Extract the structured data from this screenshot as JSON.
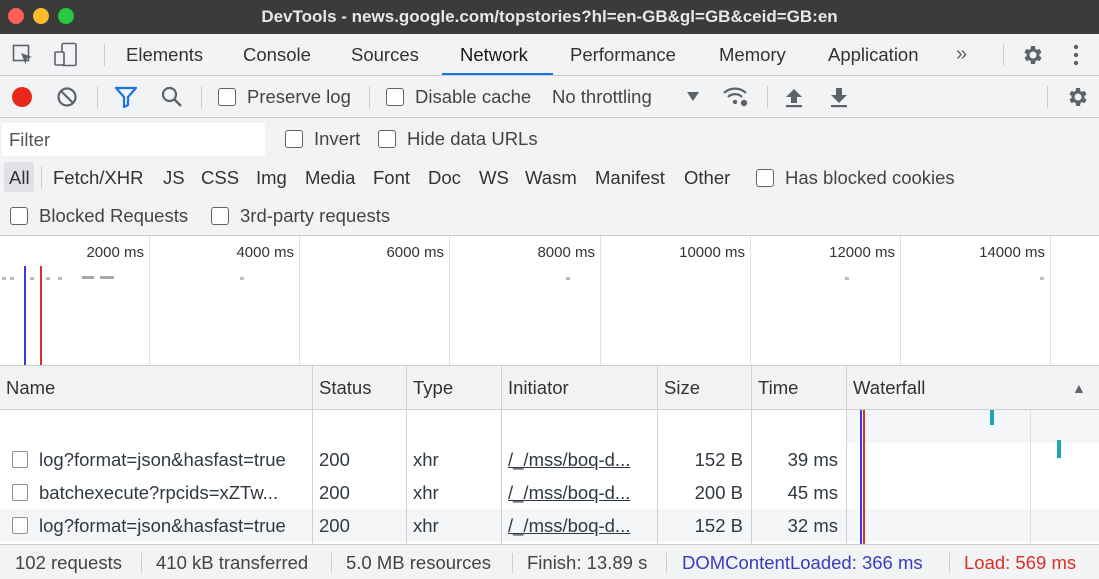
{
  "window": {
    "title": "DevTools - news.google.com/topstories?hl=en-GB&gl=GB&ceid=GB:en"
  },
  "tabs": [
    {
      "label": "Elements"
    },
    {
      "label": "Console"
    },
    {
      "label": "Sources"
    },
    {
      "label": "Network",
      "active": true
    },
    {
      "label": "Performance"
    },
    {
      "label": "Memory"
    },
    {
      "label": "Application"
    }
  ],
  "tab_overflow": "»",
  "toolbar": {
    "preserve_log_label": "Preserve log",
    "disable_cache_label": "Disable cache",
    "throttling_value": "No throttling",
    "record_color": "#e8281b",
    "filter_active_color": "#1a73e8"
  },
  "filters": {
    "filter_placeholder": "Filter",
    "invert_label": "Invert",
    "hide_data_urls_label": "Hide data URLs",
    "types": [
      "All",
      "Fetch/XHR",
      "JS",
      "CSS",
      "Img",
      "Media",
      "Font",
      "Doc",
      "WS",
      "Wasm",
      "Manifest",
      "Other"
    ],
    "active_type": "All",
    "has_blocked_cookies_label": "Has blocked cookies",
    "blocked_requests_label": "Blocked Requests",
    "third_party_label": "3rd-party requests"
  },
  "overview": {
    "ticks": [
      "2000 ms",
      "4000 ms",
      "6000 ms",
      "8000 ms",
      "10000 ms",
      "12000 ms",
      "14000 ms"
    ],
    "dom_content_loaded_color": "#3b3bd6",
    "load_color": "#d93025"
  },
  "table": {
    "columns": [
      "Name",
      "Status",
      "Type",
      "Initiator",
      "Size",
      "Time",
      "Waterfall"
    ],
    "sort_indicator": "▲",
    "rows": [
      {
        "name": "log?format=json&hasfast=true",
        "status": "200",
        "type": "xhr",
        "initiator": "/_/mss/boq-d...",
        "size": "152 B",
        "time": "39 ms"
      },
      {
        "name": "batchexecute?rpcids=xZTw...",
        "status": "200",
        "type": "xhr",
        "initiator": "/_/mss/boq-d...",
        "size": "200 B",
        "time": "45 ms"
      },
      {
        "name": "log?format=json&hasfast=true",
        "status": "200",
        "type": "xhr",
        "initiator": "/_/mss/boq-d...",
        "size": "152 B",
        "time": "32 ms"
      }
    ]
  },
  "status": {
    "requests": "102 requests",
    "transferred": "410 kB transferred",
    "resources": "5.0 MB resources",
    "finish": "Finish: 13.89 s",
    "dom_content_loaded": "DOMContentLoaded: 366 ms",
    "load": "Load: 569 ms",
    "dom_color": "#3b3bbf",
    "load_color": "#d93025"
  },
  "icons": [
    "inspect-element-icon",
    "device-toolbar-icon",
    "more-tabs-icon",
    "settings-gear-icon",
    "kebab-menu-icon",
    "record-icon",
    "clear-icon",
    "filter-funnel-icon",
    "search-icon",
    "throttle-dropdown-icon",
    "network-conditions-icon",
    "import-har-icon",
    "export-har-icon",
    "network-settings-gear-icon"
  ]
}
